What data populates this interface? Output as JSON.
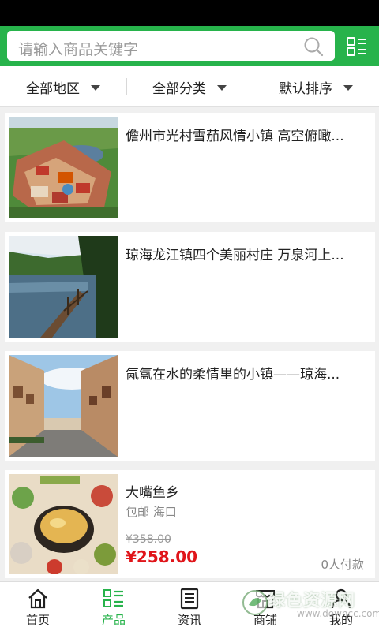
{
  "search": {
    "placeholder": "请输入商品关键字"
  },
  "filters": [
    {
      "label": "全部地区"
    },
    {
      "label": "全部分类"
    },
    {
      "label": "默认排序"
    }
  ],
  "products": [
    {
      "title": "儋州市光村雪茄风情小镇 高空俯瞰..."
    },
    {
      "title": "琼海龙江镇四个美丽村庄 万泉河上..."
    },
    {
      "title": "氤氲在水的柔情里的小镇——琼海..."
    },
    {
      "title": "大嘴鱼乡",
      "shipping": "包邮 海口",
      "old_price": "¥358.00",
      "price": "¥258.00",
      "paid_count": "0人付款"
    }
  ],
  "tabs": [
    {
      "label": "首页",
      "icon": "home-icon"
    },
    {
      "label": "产品",
      "icon": "list-icon"
    },
    {
      "label": "资讯",
      "icon": "news-icon"
    },
    {
      "label": "商铺",
      "icon": "store-icon"
    },
    {
      "label": "我的",
      "icon": "user-icon"
    }
  ],
  "active_tab": "产品",
  "watermark": {
    "main": "绿色资源网",
    "sub": "www.downcc.com"
  },
  "colors": {
    "brand": "#27b34b",
    "price": "#e0151a",
    "text": "#222222",
    "muted": "#888888"
  }
}
